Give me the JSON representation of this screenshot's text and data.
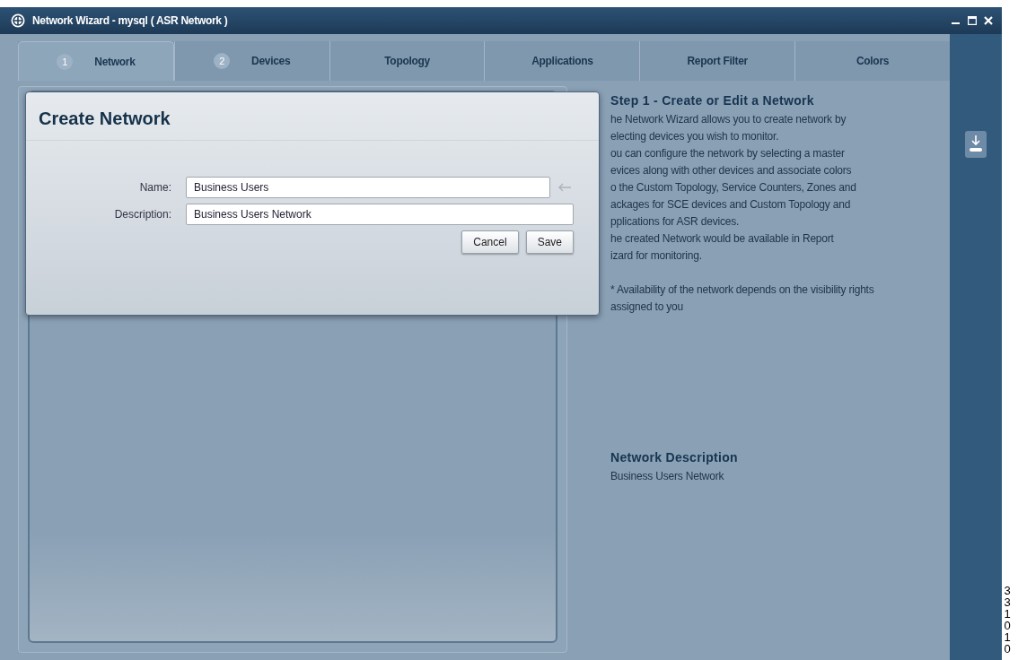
{
  "window": {
    "title": "Network Wizard - mysql ( ASR Network )"
  },
  "tabs": [
    {
      "number": "1",
      "label": "Network",
      "selected": true
    },
    {
      "number": "2",
      "label": "Devices",
      "selected": false
    },
    {
      "label": "Topology",
      "selected": false
    },
    {
      "label": "Applications",
      "selected": false
    },
    {
      "label": "Report Filter",
      "selected": false
    },
    {
      "label": "Colors",
      "selected": false
    }
  ],
  "dialog": {
    "title": "Create Network",
    "fields": [
      {
        "label": "Name:",
        "value": "Business Users"
      },
      {
        "label": "Description:",
        "value": "Business Users Network"
      }
    ],
    "buttons": [
      "Cancel",
      "Save"
    ]
  },
  "help": {
    "heading": "Step 1 - Create or Edit a Network",
    "lines": [
      "he Network Wizard allows you to create network by",
      "electing devices you wish to monitor.",
      "ou can configure the network by selecting a master",
      "evices along with other devices and associate colors",
      "o the Custom Topology, Service Counters, Zones and",
      "ackages for SCE devices and Custom Topology and",
      "pplications for ASR devices.",
      "he created Network would be available in Report",
      "izard for monitoring."
    ],
    "note": "* Availability of the network depends on the visibility rights assigned to you"
  },
  "description": {
    "heading": "Network Description",
    "text": "Business Users Network"
  },
  "figure_id": "331010"
}
